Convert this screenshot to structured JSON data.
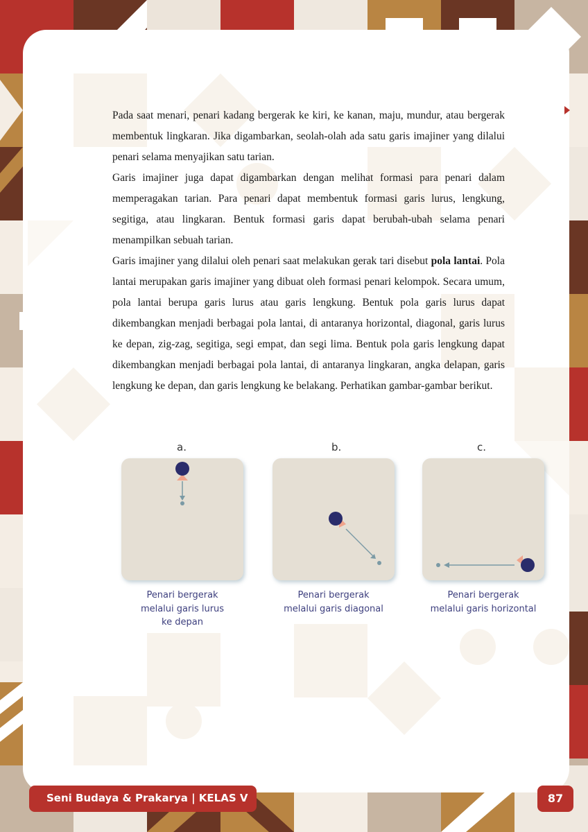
{
  "body_text": {
    "p1": "Pada saat menari, penari kadang bergerak ke kiri, ke kanan, maju, mundur, atau bergerak membentuk lingkaran. Jika digambarkan, seolah-olah ada satu garis imajiner yang dilalui penari selama menyajikan satu tarian.",
    "p2": "Garis imajiner juga dapat digambarkan dengan melihat formasi para penari dalam memperagakan tarian. Para penari dapat membentuk formasi garis lurus, lengkung, segitiga, atau lingkaran. Bentuk formasi garis dapat berubah-ubah selama penari menampilkan sebuah tarian.",
    "p3_before": "Garis imajiner yang dilalui oleh penari saat melakukan gerak tari disebut ",
    "p3_bold": "pola lantai",
    "p3_after": ". Pola lantai merupakan garis imajiner yang dibuat oleh formasi penari kelompok. Secara umum, pola lantai berupa garis lurus atau garis lengkung. Bentuk pola garis lurus dapat dikembangkan menjadi berbagai pola lantai, di antaranya horizontal, diagonal, garis lurus ke depan, zig-zag, segitiga, segi empat, dan segi lima. Bentuk pola garis lengkung dapat dikembangkan menjadi berbagai pola lantai, di antaranya lingkaran, angka delapan, garis lengkung ke depan, dan garis lengkung ke belakang. Perhatikan gambar-gambar berikut."
  },
  "figures": [
    {
      "letter": "a.",
      "caption_lines": [
        "Penari bergerak",
        "melalui garis lurus",
        "ke depan"
      ]
    },
    {
      "letter": "b.",
      "caption_lines": [
        "Penari bergerak",
        "melalui garis diagonal"
      ]
    },
    {
      "letter": "c.",
      "caption_lines": [
        "Penari bergerak",
        "melalui garis horizontal"
      ]
    }
  ],
  "footer": {
    "book_title": "Seni Budaya & Prakarya | KELAS V",
    "page_number": "87"
  },
  "colors": {
    "red": "#b7322c",
    "brown": "#6a3624",
    "ochre": "#b98543",
    "tan": "#c7b5a2",
    "dancer": "#2a2c6b",
    "direction_marker": "#f0a48c",
    "path_line": "#7b9aa5"
  },
  "icons": {
    "page_marker": "red-triangle-icon",
    "dancer": "dancer-dot-icon"
  }
}
